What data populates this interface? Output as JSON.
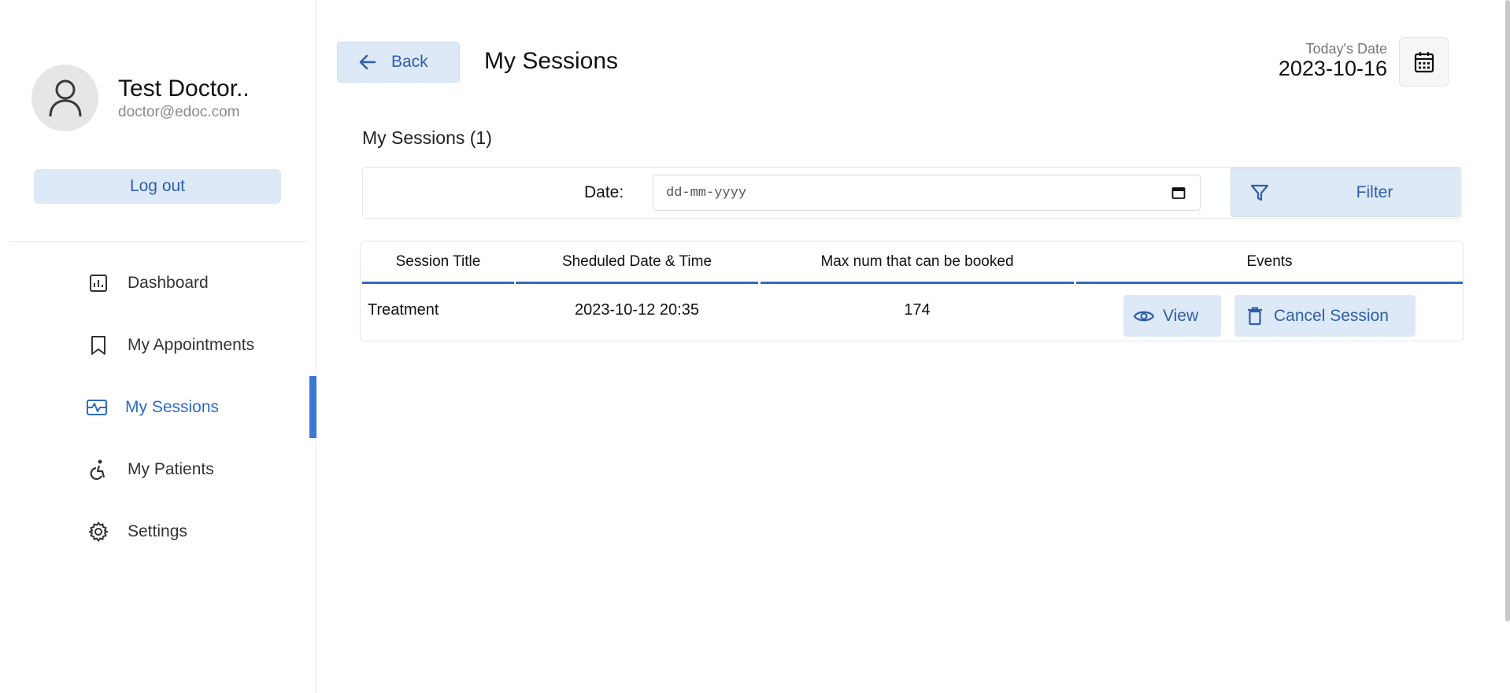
{
  "sidebar": {
    "profile": {
      "name": "Test Doctor..",
      "email": "doctor@edoc.com"
    },
    "logout_label": "Log out",
    "items": [
      {
        "label": "Dashboard",
        "icon": "chart-icon"
      },
      {
        "label": "My Appointments",
        "icon": "bookmark-icon"
      },
      {
        "label": "My Sessions",
        "icon": "sessions-icon",
        "active": true
      },
      {
        "label": "My Patients",
        "icon": "accessible-icon"
      },
      {
        "label": "Settings",
        "icon": "gear-icon"
      }
    ]
  },
  "header": {
    "back_label": "Back",
    "title": "My Sessions",
    "today_label": "Today's Date",
    "today_value": "2023-10-16"
  },
  "content": {
    "section_title": "My Sessions (1)",
    "filter": {
      "date_label": "Date:",
      "date_placeholder": "dd-mm-yyyy",
      "button_label": "Filter"
    },
    "table": {
      "columns": [
        "Session Title",
        "Sheduled Date & Time",
        "Max num that can be booked",
        "Events"
      ],
      "rows": [
        {
          "title": "Treatment",
          "datetime": "2023-10-12 20:35",
          "max": "174",
          "view_label": "View",
          "cancel_label": "Cancel Session"
        }
      ]
    }
  },
  "colors": {
    "accent": "#2f6bc4",
    "button_bg": "#dde9f7",
    "button_text": "#2f5fa8"
  }
}
